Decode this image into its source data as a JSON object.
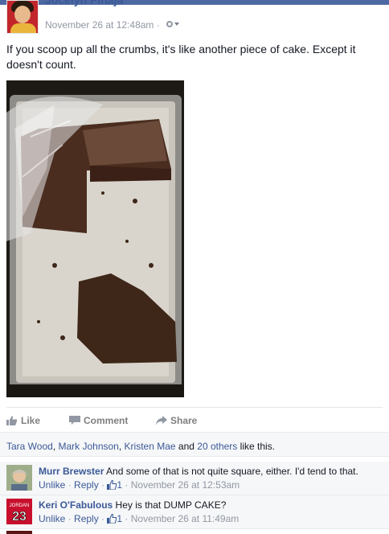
{
  "post": {
    "author": "Jocelyn Pinaja",
    "timestamp": "November 26 at 12:48am",
    "privacy_separator": "·",
    "settings_icon": "gear-icon",
    "text": "If you scoop up all the crumbs, it's like another piece of cake. Except it doesn't count."
  },
  "actions": {
    "like": "Like",
    "comment": "Comment",
    "share": "Share"
  },
  "likes": {
    "person1": "Tara Wood",
    "sep1": ", ",
    "person2": "Mark Johnson",
    "sep2": ", ",
    "person3": "Kristen Mae",
    "and": " and ",
    "others": "20 others",
    "suffix": " like this."
  },
  "comments": [
    {
      "author": "Murr Brewster",
      "text": "And some of that is not quite square, either. I'd tend to that.",
      "unlike": "Unlike",
      "dot1": " · ",
      "reply": "Reply",
      "dot2": " · ",
      "like_count": "1",
      "dot3": " · ",
      "timestamp": "November 26 at 12:53am"
    },
    {
      "author": "Keri O'Fabulous",
      "text": "Hey is that DUMP CAKE?",
      "unlike": "Unlike",
      "dot1": " · ",
      "reply": "Reply",
      "dot2": " · ",
      "like_count": "1",
      "dot3": " · ",
      "timestamp": "November 26 at 11:49am",
      "avatar_text": "JORDAN",
      "avatar_number": "23"
    }
  ],
  "colors": {
    "link": "#3b5998",
    "meta": "#9197a3",
    "panel": "#f6f7f8"
  }
}
